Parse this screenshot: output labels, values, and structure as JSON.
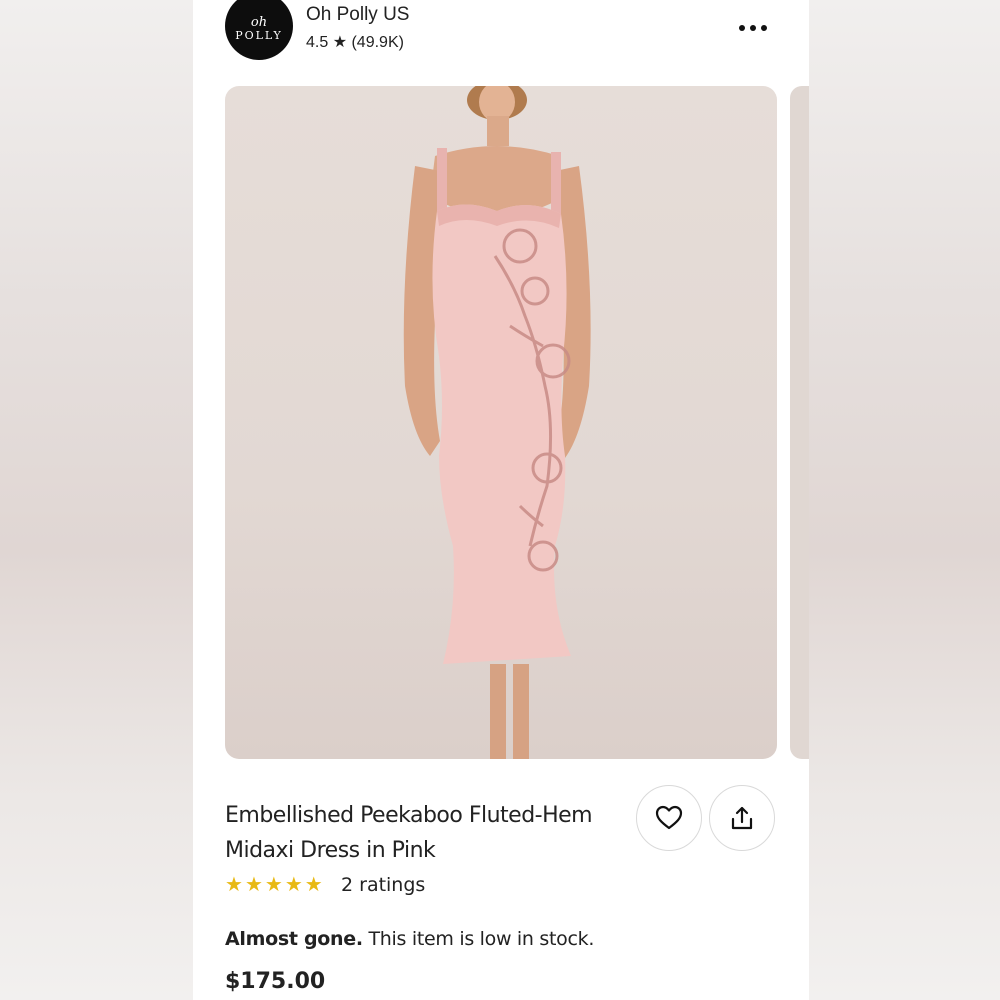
{
  "shop": {
    "logo_top": "oh",
    "logo_bottom": "POLLY",
    "name": "Oh Polly US",
    "rating": "4.5 ★ (49.9K)"
  },
  "product": {
    "title_line1": "Embellished Peekaboo Fluted-Hem",
    "title_line2": "Midaxi Dress in Pink",
    "ratings_count": "2 ratings",
    "stars": 5,
    "stock_bold": "Almost gone.",
    "stock_text": " This item is low in stock.",
    "price": "$175.00"
  },
  "colors": {
    "star": "#e8b914",
    "dress": "#f2c8c4",
    "panel_bg": "#ffffff"
  },
  "icons": {
    "more": "more-horizontal-icon",
    "favorite": "heart-icon",
    "share": "share-icon"
  }
}
